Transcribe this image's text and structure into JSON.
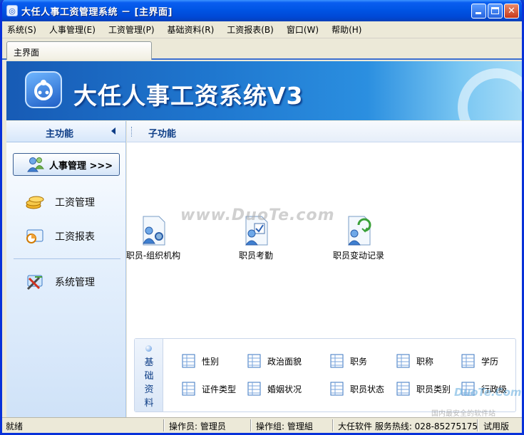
{
  "window": {
    "title": "大任人事工资管理系统 － [主界面]"
  },
  "menu": [
    "系统(S)",
    "人事管理(E)",
    "工资管理(P)",
    "基础资料(R)",
    "工资报表(B)",
    "窗口(W)",
    "帮助(H)"
  ],
  "tab": {
    "label": "主界面"
  },
  "banner": {
    "title": "大任人事工资系统V3"
  },
  "left_nav": {
    "header": "主功能",
    "active": "人事管理 >>>",
    "items": [
      "工资管理",
      "工资报表",
      "系统管理"
    ]
  },
  "content": {
    "header": "子功能",
    "functions": [
      "职员-组织机构",
      "职员考勤",
      "职员变动记录"
    ]
  },
  "basic_data": {
    "side_label": "基础资料",
    "side_chars": [
      "基",
      "础",
      "资",
      "料"
    ],
    "row1": [
      "性别",
      "政治面貌",
      "职务",
      "职称",
      "学历"
    ],
    "row2": [
      "证件类型",
      "婚姻状况",
      "职员状态",
      "职员类别",
      "行政级"
    ]
  },
  "status": {
    "ready": "就绪",
    "operator": "操作员: 管理员",
    "group": "操作组: 管理組",
    "company": "大任软件 服务热线: 028-85275175",
    "edition": "试用版"
  },
  "watermark": {
    "text": "www.DuoTe.com",
    "logo_text": "DuoTe.Com",
    "tagline": "国内最安全的软件站"
  },
  "colors": {
    "titlebar": "#0055e5",
    "banner": "#1f77cf",
    "nav_text": "#0d3d86"
  }
}
